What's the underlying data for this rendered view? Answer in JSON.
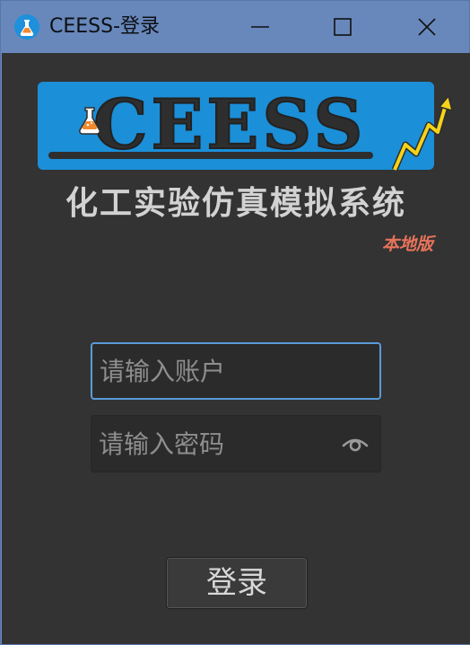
{
  "window": {
    "title": "CEESS-登录"
  },
  "logo": {
    "text": "CEESS"
  },
  "header": {
    "subtitle": "化工实验仿真模拟系统",
    "edition": "本地版"
  },
  "form": {
    "account_placeholder": "请输入账户",
    "account_value": "",
    "password_placeholder": "请输入密码",
    "password_value": "",
    "login_label": "登录"
  },
  "colors": {
    "titlebar": "#6888bb",
    "background": "#333333",
    "logo_blue": "#1b8fd8",
    "edition_red": "#e8735a",
    "focus_border": "#5b9ad8"
  },
  "icons": {
    "app": "flask-icon",
    "minimize": "minimize-icon",
    "maximize": "maximize-icon",
    "close": "close-icon",
    "password_toggle": "eye-icon"
  }
}
